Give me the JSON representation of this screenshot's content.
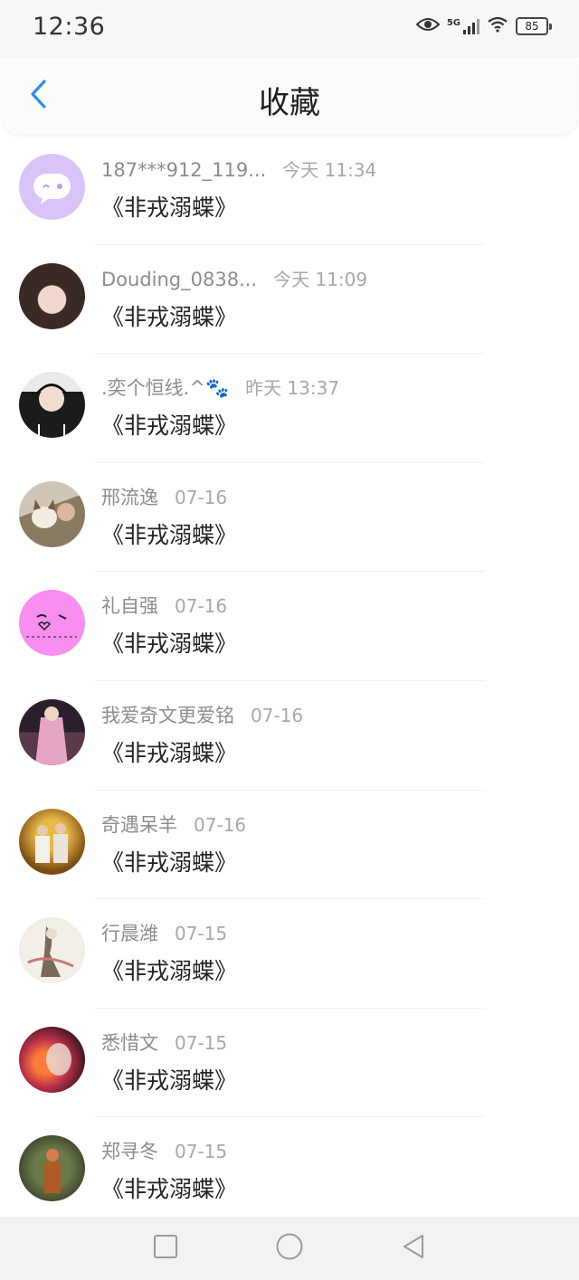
{
  "status_bar": {
    "time": "12:36",
    "network": "5G",
    "battery": "85",
    "icons": [
      "eye-icon",
      "signal-icon",
      "wifi-icon",
      "battery-icon"
    ]
  },
  "header": {
    "title": "收藏",
    "back_icon": "chevron-left-icon",
    "accent": "#2f8de4"
  },
  "items": [
    {
      "name": "187***912_119...",
      "time": "今天 11:34",
      "title": "《非戎溺蝶》",
      "avatar": "chat-bubble-avatar"
    },
    {
      "name": "Douding_0838...",
      "time": "今天 11:09",
      "title": "《非戎溺蝶》",
      "avatar": "user-photo-avatar"
    },
    {
      "name": ".奕个恒线.^🐾",
      "time": "昨天 13:37",
      "title": "《非戎溺蝶》",
      "avatar": "user-photo-avatar"
    },
    {
      "name": "邢流逸",
      "time": "07-16",
      "title": "《非戎溺蝶》",
      "avatar": "user-photo-avatar"
    },
    {
      "name": "礼自强",
      "time": "07-16",
      "title": "《非戎溺蝶》",
      "avatar": "pink-sticker-avatar"
    },
    {
      "name": "我爱奇文更爱铭",
      "time": "07-16",
      "title": "《非戎溺蝶》",
      "avatar": "user-photo-avatar"
    },
    {
      "name": "奇遇呆羊",
      "time": "07-16",
      "title": "《非戎溺蝶》",
      "avatar": "user-photo-avatar"
    },
    {
      "name": "行晨潍",
      "time": "07-15",
      "title": "《非戎溺蝶》",
      "avatar": "user-photo-avatar"
    },
    {
      "name": "悉惜文",
      "time": "07-15",
      "title": "《非戎溺蝶》",
      "avatar": "user-photo-avatar"
    },
    {
      "name": "郑寻冬",
      "time": "07-15",
      "title": "《非戎溺蝶》",
      "avatar": "user-photo-avatar"
    }
  ],
  "nav_bar": {
    "icons": [
      "square-recents-icon",
      "circle-home-icon",
      "triangle-back-icon"
    ]
  }
}
